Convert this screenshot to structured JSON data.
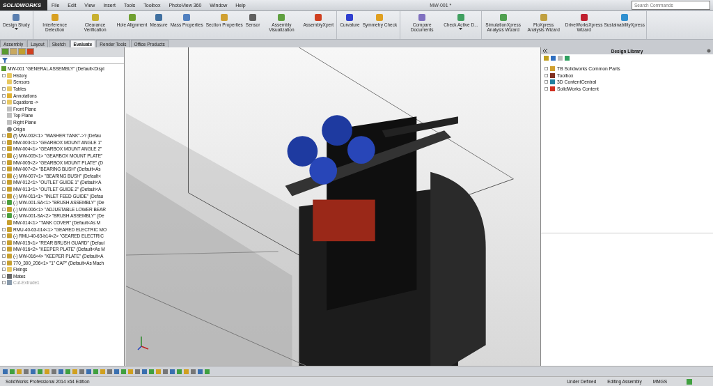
{
  "app": {
    "logo": "SOLIDWORKS"
  },
  "menu": [
    "File",
    "Edit",
    "View",
    "Insert",
    "Tools",
    "Toolbox",
    "PhotoView 360",
    "Window",
    "Help"
  ],
  "window": {
    "title": "MW-001 *"
  },
  "search": {
    "placeholder": "Search Commands"
  },
  "ribbon": {
    "groups": [
      [
        {
          "label": "Design Study",
          "dropdown": true,
          "color": "#5a7fb0"
        }
      ],
      [
        {
          "label": "Interference Detection",
          "dropdown": false,
          "color": "#d8a020"
        },
        {
          "label": "Clearance Verification",
          "dropdown": false,
          "color": "#c8b030"
        },
        {
          "label": "Hole Alignment",
          "dropdown": false,
          "color": "#70a030"
        },
        {
          "label": "Measure",
          "dropdown": false,
          "color": "#4070a0"
        },
        {
          "label": "Mass Properties",
          "dropdown": false,
          "color": "#5080c0"
        },
        {
          "label": "Section Properties",
          "dropdown": false,
          "color": "#d0a030"
        },
        {
          "label": "Sensor",
          "dropdown": false,
          "color": "#606060"
        },
        {
          "label": "Assembly Visualization",
          "dropdown": false,
          "color": "#60a040"
        },
        {
          "label": "AssemblyXpert",
          "dropdown": false,
          "color": "#d04020"
        }
      ],
      [
        {
          "label": "Curvature",
          "dropdown": false,
          "color": "#3040d0"
        },
        {
          "label": "Symmetry Check",
          "dropdown": false,
          "color": "#e0a020"
        }
      ],
      [
        {
          "label": "Compare Documents",
          "dropdown": false,
          "color": "#8070c0"
        },
        {
          "label": "Check Active D...",
          "dropdown": true,
          "color": "#40a060"
        }
      ],
      [
        {
          "label": "SimulationXpress Analysis Wizard",
          "dropdown": false,
          "color": "#50a050"
        },
        {
          "label": "FloXpress Analysis Wizard",
          "dropdown": false,
          "color": "#c0a040"
        },
        {
          "label": "DriveWorksXpress Wizard",
          "dropdown": false,
          "color": "#c02030"
        },
        {
          "label": "SustainabilityXpress",
          "dropdown": false,
          "color": "#3090d0"
        }
      ]
    ]
  },
  "tabs": [
    {
      "label": "Assembly",
      "selected": false
    },
    {
      "label": "Layout",
      "selected": false
    },
    {
      "label": "Sketch",
      "selected": false
    },
    {
      "label": "Evaluate",
      "selected": true
    },
    {
      "label": "Render Tools",
      "selected": false
    },
    {
      "label": "Office Products",
      "selected": false
    }
  ],
  "feature_tree": {
    "root": {
      "label": "MW-001 \"GENERAL ASSEMBLY\" (Default<Displ",
      "children": [
        {
          "label": "History",
          "kind": "folder",
          "expandable": true,
          "suppressed": false
        },
        {
          "label": "Sensors",
          "kind": "folder",
          "expandable": false,
          "suppressed": false
        },
        {
          "label": "Tables",
          "kind": "folder",
          "expandable": true,
          "suppressed": false
        },
        {
          "label": "Annotations",
          "kind": "annotation",
          "expandable": true,
          "suppressed": false
        },
        {
          "label": "Equations ->",
          "kind": "folder",
          "expandable": true,
          "suppressed": false
        },
        {
          "label": "Front Plane",
          "kind": "plane",
          "expandable": false,
          "suppressed": false
        },
        {
          "label": "Top Plane",
          "kind": "plane",
          "expandable": false,
          "suppressed": false
        },
        {
          "label": "Right Plane",
          "kind": "plane",
          "expandable": false,
          "suppressed": false
        },
        {
          "label": "Origin",
          "kind": "origin",
          "expandable": false,
          "suppressed": false
        },
        {
          "label": "(f) MW-002<1> \"WASHER TANK\"->? (Defau",
          "kind": "part",
          "expandable": true,
          "suppressed": false
        },
        {
          "label": "MW-003<1> \"GEARBOX MOUNT ANGLE 1\"",
          "kind": "part",
          "expandable": true,
          "suppressed": false
        },
        {
          "label": "MW-004<1> \"GEARBOX MOUNT ANGLE 2\"",
          "kind": "part",
          "expandable": true,
          "suppressed": false
        },
        {
          "label": "(-) MW-005<1> \"GEARBOX MOUNT PLATE\"",
          "kind": "part",
          "expandable": true,
          "suppressed": false
        },
        {
          "label": "MW-005<2> \"GEARBOX MOUNT PLATE\" (D",
          "kind": "part",
          "expandable": true,
          "suppressed": false
        },
        {
          "label": "MW-007<2> \"BEARING BUSH\" (Default<As",
          "kind": "part",
          "expandable": true,
          "suppressed": false
        },
        {
          "label": "(-) MW-007<1> \"BEARING BUSH\" (Default<",
          "kind": "part",
          "expandable": true,
          "suppressed": false
        },
        {
          "label": "MW-012<1> \"OUTLET GUIDE 1\" (Default<A",
          "kind": "part",
          "expandable": true,
          "suppressed": false
        },
        {
          "label": "MW-013<1> \"OUTLET GUIDE 2\" (Default<A",
          "kind": "part",
          "expandable": true,
          "suppressed": false
        },
        {
          "label": "(-) MW-011<1> \"INLET FEED GUIDE\" (Defau",
          "kind": "part",
          "expandable": true,
          "suppressed": false
        },
        {
          "label": "(-) MW-001-SA<1> \"BRUSH ASSEMBLY\" (De",
          "kind": "assembly",
          "expandable": true,
          "suppressed": false
        },
        {
          "label": "(-) MW-006<1> \"ADJUSTABLE LOWER BEAR",
          "kind": "part",
          "expandable": true,
          "suppressed": false
        },
        {
          "label": "(-) MW-001-SA<2> \"BRUSH ASSEMBLY\" (De",
          "kind": "assembly",
          "expandable": true,
          "suppressed": false
        },
        {
          "label": "MW-014<1> \"TANK COVER\" (Default<As M",
          "kind": "part",
          "expandable": false,
          "suppressed": false
        },
        {
          "label": "RMU-40-63-b14<1> \"GEARED ELECTRIC MO",
          "kind": "part",
          "expandable": true,
          "suppressed": false
        },
        {
          "label": "(-) RMU-40-63-b14<2> \"GEARED ELECTRIC",
          "kind": "part",
          "expandable": true,
          "suppressed": false
        },
        {
          "label": "MW-015<1> \"REAR BRUSH GUARD\" (Defaul",
          "kind": "part",
          "expandable": true,
          "suppressed": false
        },
        {
          "label": "MW-016<2> \"KEEPER PLATE\" (Default<As M",
          "kind": "part",
          "expandable": true,
          "suppressed": false
        },
        {
          "label": "(-) MW-016<4> \"KEEPER PLATE\" (Default<A",
          "kind": "part",
          "expandable": true,
          "suppressed": false
        },
        {
          "label": "770_300_206<1> \"1\" CAP\" (Default<As Mach",
          "kind": "part",
          "expandable": true,
          "suppressed": false
        },
        {
          "label": "Fixings",
          "kind": "folder",
          "expandable": true,
          "suppressed": false
        },
        {
          "label": "Mates",
          "kind": "mates",
          "expandable": true,
          "suppressed": false
        },
        {
          "label": "Cut-Extrude1",
          "kind": "feature",
          "expandable": true,
          "suppressed": true
        }
      ]
    }
  },
  "design_library": {
    "title": "Design Library",
    "items": [
      {
        "label": "TB Solidworks Common Parts",
        "color": "#d0a030"
      },
      {
        "label": "Toolbox",
        "color": "#803020"
      },
      {
        "label": "3D ContentCentral",
        "color": "#2080a0"
      },
      {
        "label": "SolidWorks Content",
        "color": "#d03020"
      }
    ]
  },
  "status_bar": {
    "edition": "SolidWorks Professional 2014 x64 Edition",
    "state": "Under Defined",
    "mode": "Editing Assembly",
    "units": "MMGS"
  }
}
